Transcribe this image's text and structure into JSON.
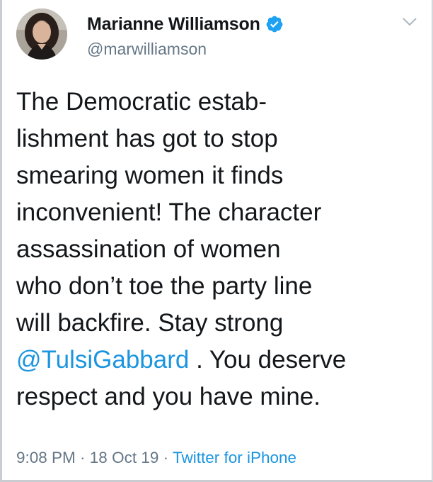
{
  "tweet": {
    "author": {
      "display_name": "Marianne Williamson",
      "handle": "@marwilliamson",
      "verified": true,
      "avatar_icon": "profile-photo"
    },
    "text_lines": [
      "The Democratic estab-",
      "lishment has got to stop",
      "smearing women it finds",
      "inconvenient! The character",
      "assassination of women",
      "who don’t toe the party line",
      "will backfire. Stay strong"
    ],
    "mention": "@TulsiGabbard",
    "after_mention": " . You deserve",
    "last_line": "respect and you have mine.",
    "time": "9:08 PM",
    "separator": " · ",
    "date": "18 Oct 19",
    "source": "Twitter for iPhone",
    "menu_icon": "chevron-down-icon"
  },
  "colors": {
    "text": "#14171a",
    "muted": "#657786",
    "link": "#1b95e0",
    "verified_badge": "#1da1f2"
  }
}
